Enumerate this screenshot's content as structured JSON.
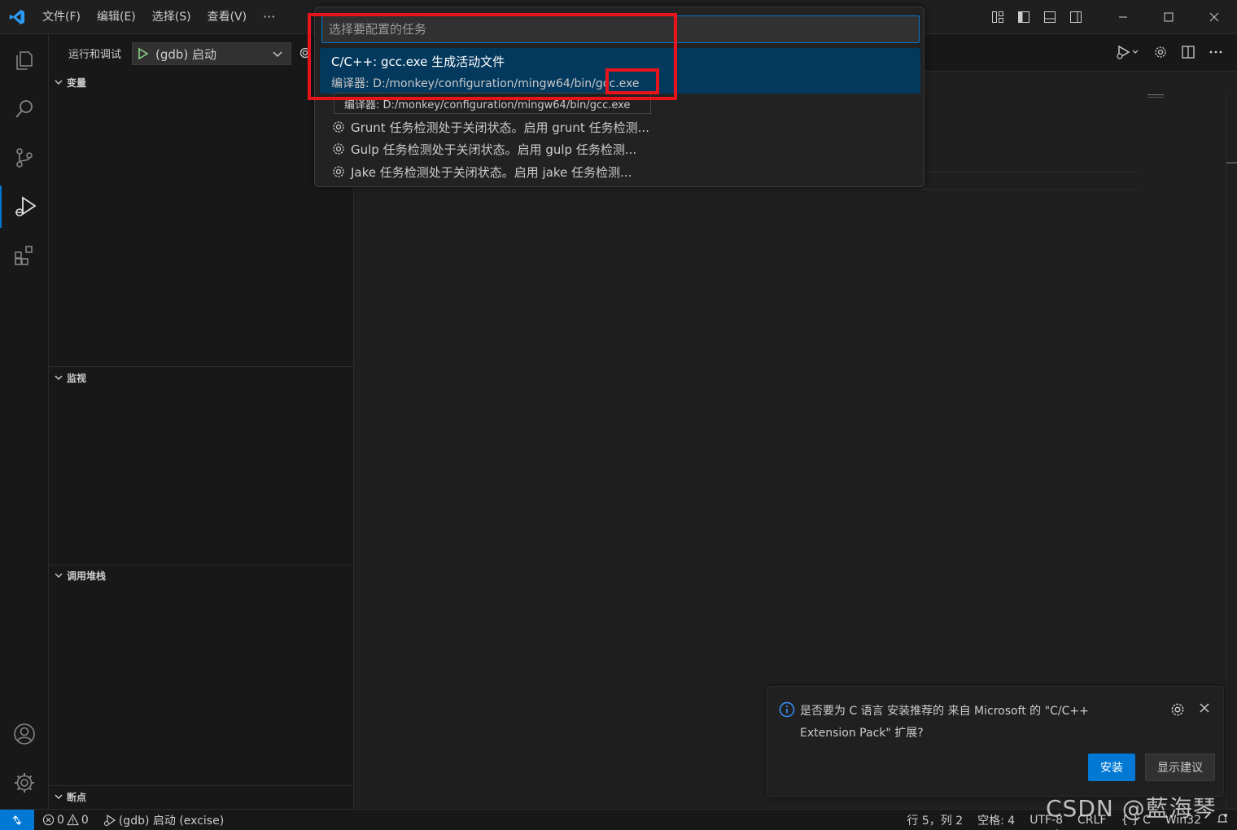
{
  "menu": {
    "file": "文件(F)",
    "edit": "编辑(E)",
    "selection": "选择(S)",
    "view": "查看(V)",
    "more": "···"
  },
  "sidebar": {
    "title": "运行和调试",
    "launch_config": "(gdb) 启动",
    "sections": {
      "variables": "变量",
      "watch": "监视",
      "callstack": "调用堆栈",
      "breakpoints": "断点"
    }
  },
  "quickpick": {
    "placeholder": "选择要配置的任务",
    "selected": {
      "title": "C/C++: gcc.exe 生成活动文件",
      "detail_prefix": "编译器: D:/monkey/configuration/mingw64/bin/",
      "detail_highlight": "gcc.exe"
    },
    "tooltip": "编译器: D:/monkey/configuration/mingw64/bin/gcc.exe",
    "items": [
      "Grunt 任务检测处于关闭状态。启用 grunt 任务检测...",
      "Gulp 任务检测处于关闭状态。启用 gulp 任务检测...",
      "Jake 任务检测处于关闭状态。启用 jake 任务检测..."
    ]
  },
  "notification": {
    "message": "是否要为 C 语言 安装推荐的 来自 Microsoft 的 \"C/C++ Extension Pack\" 扩展?",
    "install": "安装",
    "show_recommendations": "显示建议"
  },
  "statusbar": {
    "errors": "0",
    "warnings": "0",
    "debug_target": "(gdb) 启动 (excise)",
    "position": "行 5，列 2",
    "spaces": "空格: 4",
    "encoding": "UTF-8",
    "eol": "CRLF",
    "language": "{ } C",
    "platform": "Win32"
  },
  "watermark": "CSDN @藍海琴泉",
  "colors": {
    "accent": "#0078d4",
    "selection": "#04395e",
    "highlight_box": "#e8141c"
  }
}
